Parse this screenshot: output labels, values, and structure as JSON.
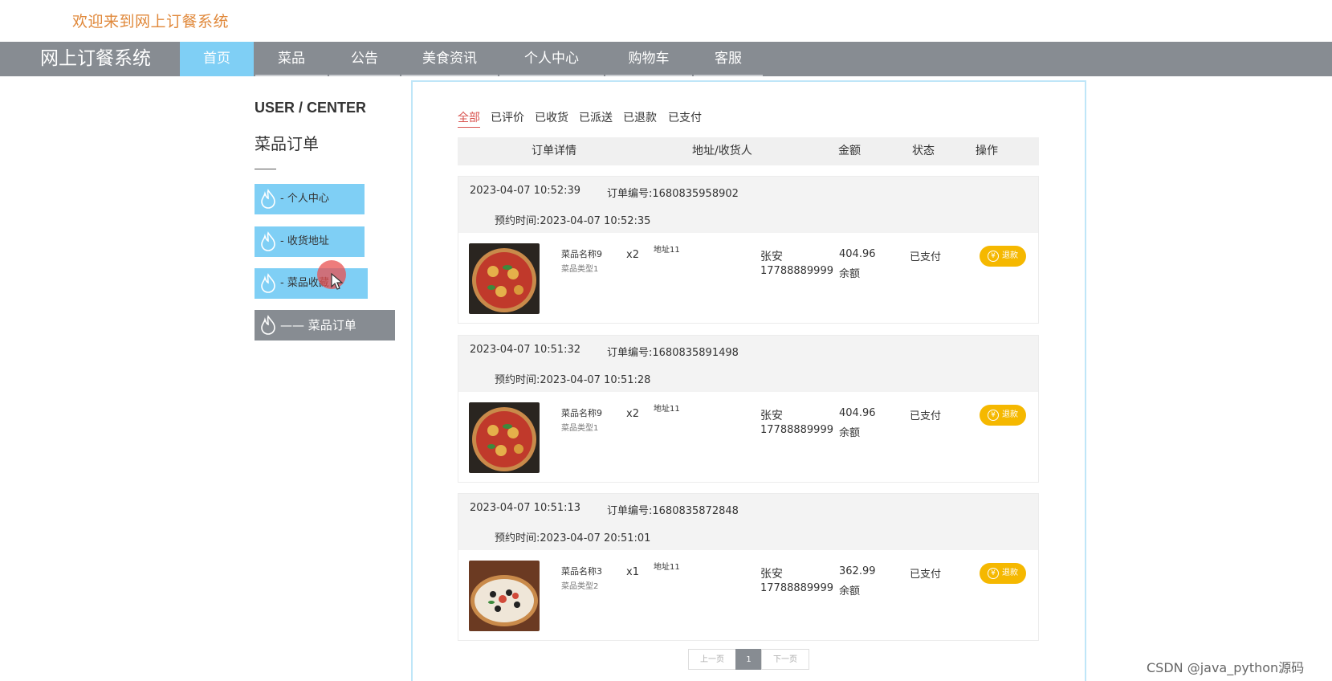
{
  "welcome_text": "欢迎来到网上订餐系统",
  "brand": "网上订餐系统",
  "nav": [
    "首页",
    "菜品",
    "公告",
    "美食资讯",
    "个人中心",
    "购物车",
    "客服"
  ],
  "sidebar": {
    "title": "USER / CENTER",
    "subtitle": "菜品订单",
    "items": [
      {
        "label": "-  个人中心",
        "icon": "flame-icon"
      },
      {
        "label": "-  收货地址",
        "icon": "flame-icon"
      },
      {
        "label": "-  菜品收藏",
        "icon": "flame-icon"
      },
      {
        "label": "——  菜品订单",
        "icon": "flame-icon",
        "active": true
      }
    ]
  },
  "tabs": [
    "全部",
    "已评价",
    "已收货",
    "已派送",
    "已退款",
    "已支付"
  ],
  "table_headers": [
    "订单详情",
    "地址/收货人",
    "金额",
    "状态",
    "操作"
  ],
  "orders": [
    {
      "datetime": "2023-04-07 10:52:39",
      "order_no": "订单编号:1680835958902",
      "booking": "预约时间:2023-04-07 10:52:35",
      "dish_name": "菜品名称9",
      "dish_type": "菜品类型1",
      "qty": "x2",
      "address": "地址11",
      "receiver": "张安",
      "phone": "17788889999",
      "amount": "404.96",
      "pay_method": "余额",
      "status": "已支付",
      "action": "退款"
    },
    {
      "datetime": "2023-04-07 10:51:32",
      "order_no": "订单编号:1680835891498",
      "booking": "预约时间:2023-04-07 10:51:28",
      "dish_name": "菜品名称9",
      "dish_type": "菜品类型1",
      "qty": "x2",
      "address": "地址11",
      "receiver": "张安",
      "phone": "17788889999",
      "amount": "404.96",
      "pay_method": "余额",
      "status": "已支付",
      "action": "退款"
    },
    {
      "datetime": "2023-04-07 10:51:13",
      "order_no": "订单编号:1680835872848",
      "booking": "预约时间:2023-04-07 20:51:01",
      "dish_name": "菜品名称3",
      "dish_type": "菜品类型2",
      "qty": "x1",
      "address": "地址11",
      "receiver": "张安",
      "phone": "17788889999",
      "amount": "362.99",
      "pay_method": "余额",
      "status": "已支付",
      "action": "退款"
    }
  ],
  "pagination": {
    "prev": "上一页",
    "current": "1",
    "next": "下一页"
  },
  "watermark": "CSDN @java_python源码",
  "colors": {
    "nav_bg": "#878c92",
    "accent_blue": "#7fcff5",
    "welcome": "#e0883a",
    "refund": "#f5b800",
    "active_tab": "#d9534f"
  }
}
